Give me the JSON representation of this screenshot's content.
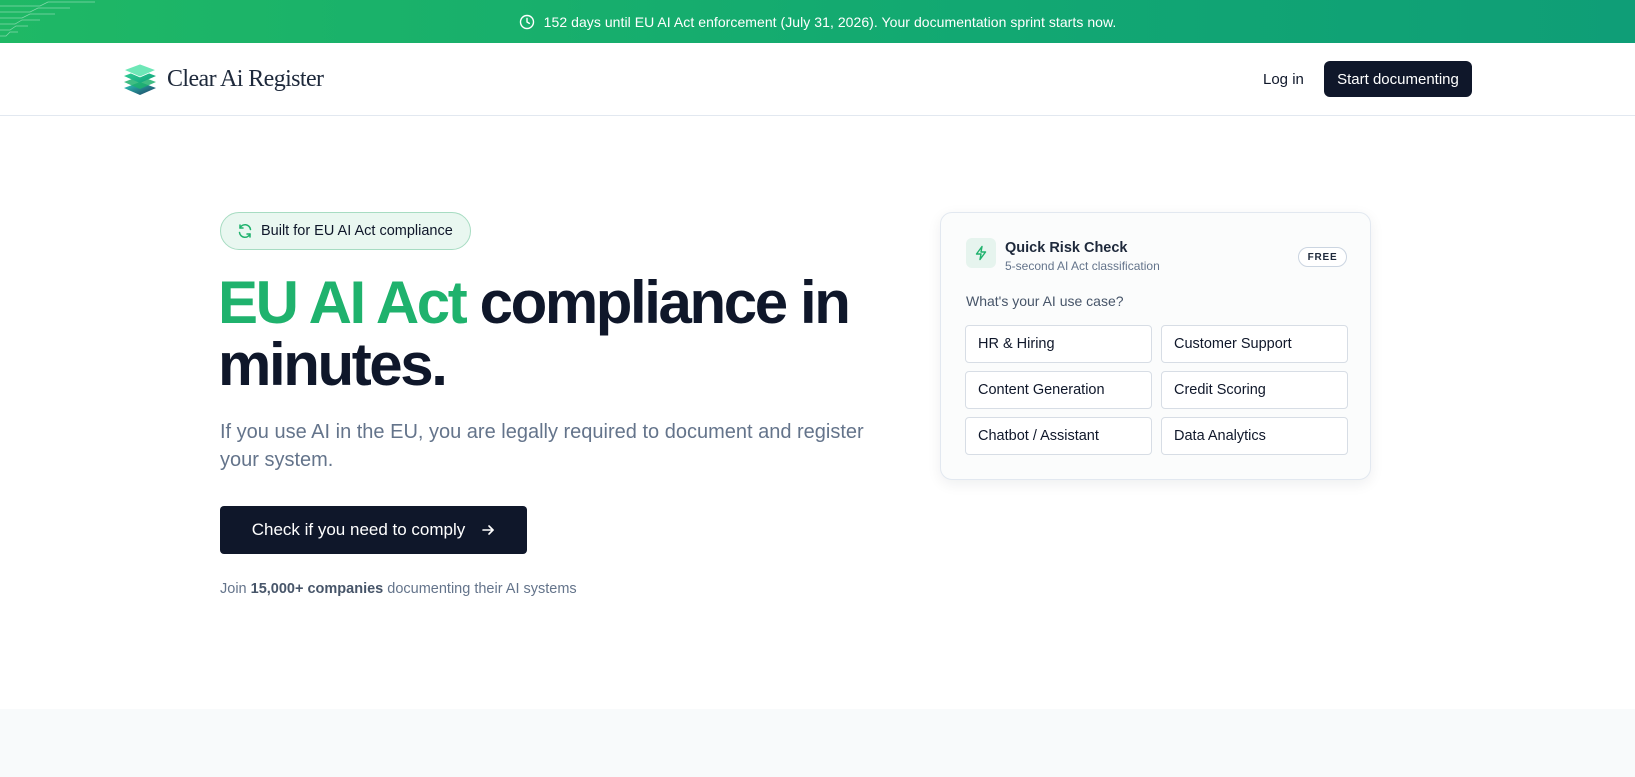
{
  "banner": {
    "text": "152 days until EU AI Act enforcement (July 31, 2026). Your documentation sprint starts now.",
    "icon": "clock-icon"
  },
  "nav": {
    "brand": "Clear Ai Register",
    "login_label": "Log in",
    "cta_label": "Start documenting"
  },
  "hero": {
    "badge": "Built for EU AI Act compliance",
    "headline_accent": "EU AI Act",
    "headline_rest_1": " compliance in",
    "headline_rest_2": "minutes.",
    "subtitle": "If you use AI in the EU, you are legally required to document and register your system.",
    "cta_label": "Check if you need to comply",
    "social_prefix": "Join ",
    "social_bold": "15,000+ companies",
    "social_suffix": " documenting their AI systems"
  },
  "risk_card": {
    "title": "Quick Risk Check",
    "subtitle": "5-second AI Act classification",
    "badge": "FREE",
    "question": "What's your AI use case?",
    "options": [
      "HR & Hiring",
      "Customer Support",
      "Content Generation",
      "Credit Scoring",
      "Chatbot / Assistant",
      "Data Analytics"
    ]
  },
  "colors": {
    "accent": "#1fb26d",
    "dark": "#0f172a",
    "banner_start": "#1fb865",
    "banner_end": "#0f9e77"
  }
}
